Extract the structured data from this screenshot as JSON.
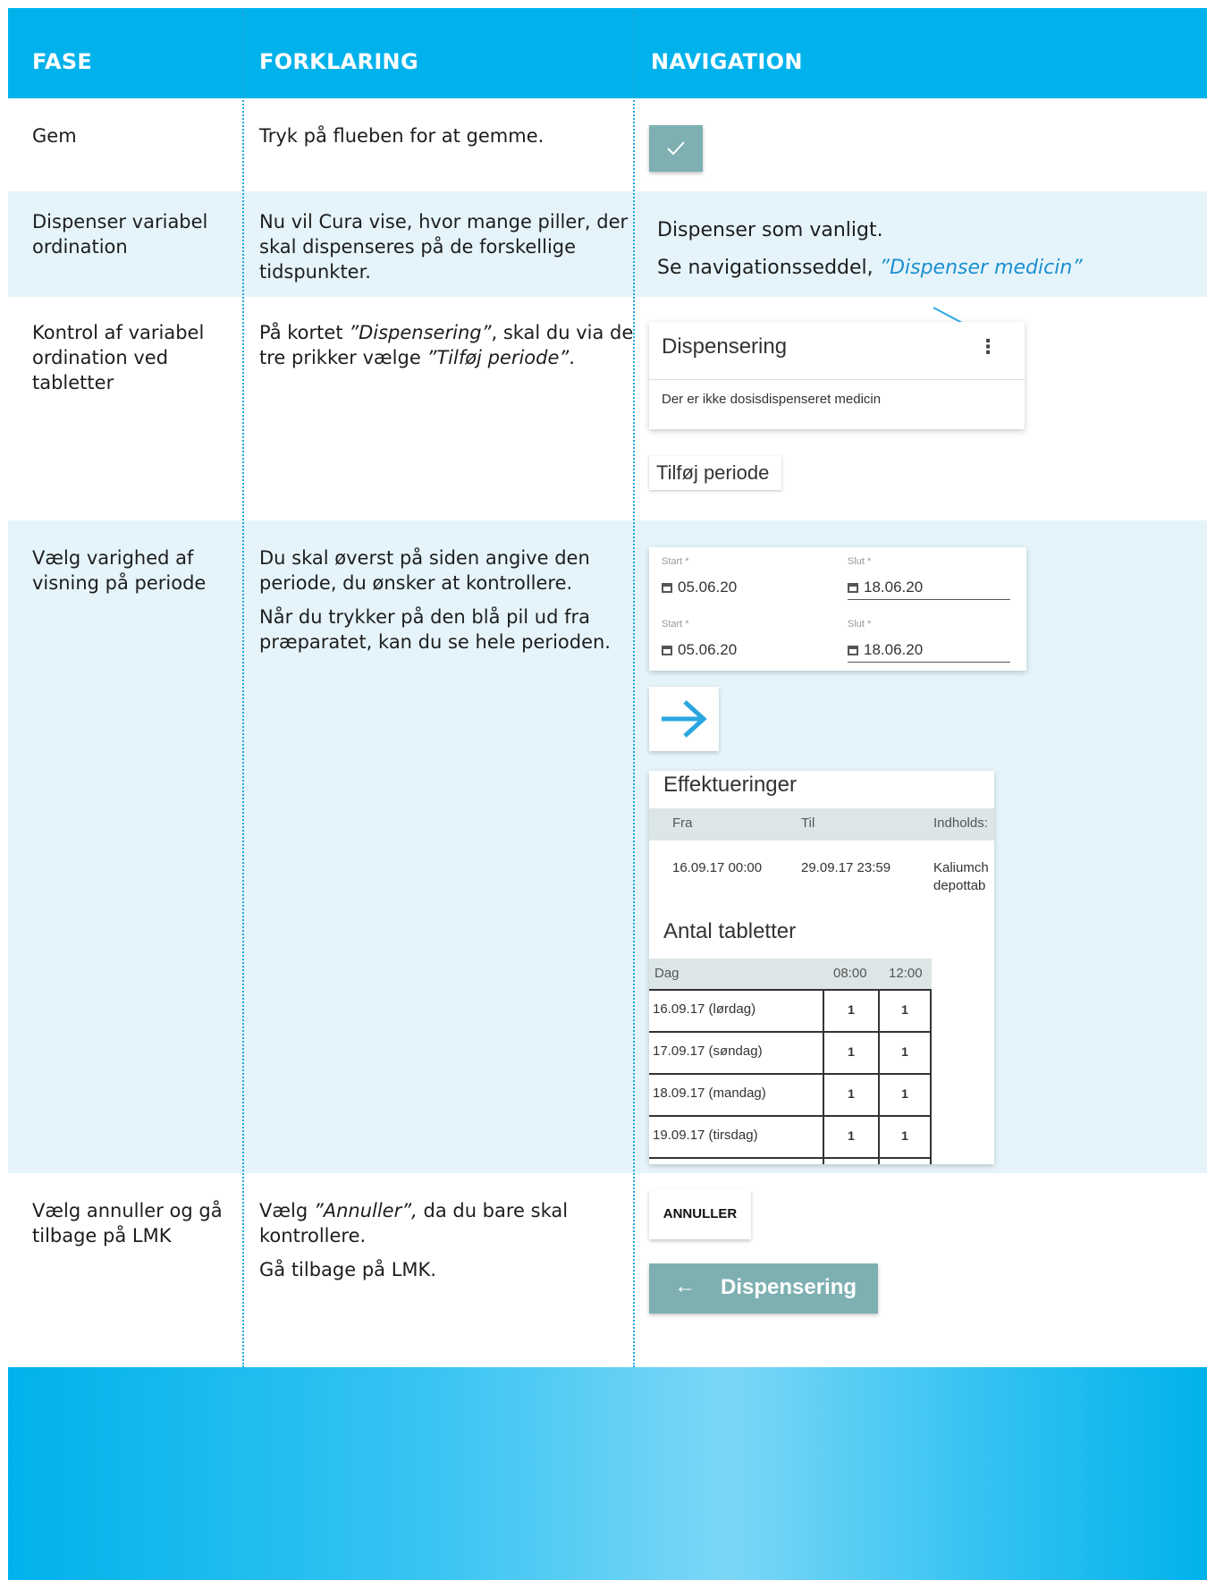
{
  "header": {
    "col1": "FASE",
    "col2": "FORKLARING",
    "col3": "NAVIGATION"
  },
  "rows": [
    {
      "fase": "Gem",
      "forklaring": [
        "Tryk på flueben for at gemme."
      ]
    },
    {
      "fase": "Dispenser variabel ordination",
      "forklaring": [
        "Nu vil Cura vise, hvor mange piller, der skal dispenseres på de forskellige tidspunkter."
      ],
      "nav_text": "Dispenser som vanligt.",
      "nav_text2_prefix": "Se navigationsseddel,",
      "nav_text2_link": "”Dispenser medicin”"
    },
    {
      "fase": "Kontrol af variabel ordination ved tabletter",
      "forklaring_p1": "På kortet",
      "forklaring_i1": "”Dispensering”",
      "forklaring_p2": ", skal du via de tre prikker vælge",
      "forklaring_i2": "”Tilføj periode”",
      "forklaring_p3": "."
    },
    {
      "fase": "Vælg varighed af visning på periode",
      "forklaring": [
        "Du skal øverst på siden angive den periode, du ønsker at kontrollere.",
        "Når du trykker på den blå pil ud fra præparatet, kan du se hele perioden."
      ]
    },
    {
      "fase": "Vælg annuller og gå tilbage på LMK",
      "forklaring_p1": "Vælg",
      "forklaring_i1": "”Annuller”,",
      "forklaring_p2": "da du bare skal kontrollere.",
      "forklaring_2": "Gå tilbage på LMK."
    }
  ],
  "nav": {
    "card_title": "Dispensering",
    "card_dots": "⋮",
    "card_sub": "Der er ikke dosisdispenseret medicin",
    "tilfoj": "Tilføj periode",
    "dates": [
      {
        "start_label": "Start *",
        "start": "05.06.20",
        "slut_label": "Slut *",
        "slut": "18.06.20"
      },
      {
        "start_label": "Start *",
        "start": "05.06.20",
        "slut_label": "Slut *",
        "slut": "18.06.20"
      }
    ],
    "eff_title": "Effektueringer",
    "eff_cols": [
      "Fra",
      "Til",
      "Indholds:"
    ],
    "eff_row": {
      "fra": "16.09.17 00:00",
      "til": "29.09.17 23:59",
      "ind1": "Kaliumch",
      "ind2": "depottab"
    },
    "antal_title": "Antal tabletter",
    "antal_cols": [
      "Dag",
      "08:00",
      "12:00"
    ],
    "antal_rows": [
      {
        "dag": "16.09.17 (lørdag)",
        "a": "1",
        "b": "1"
      },
      {
        "dag": "17.09.17 (søndag)",
        "a": "1",
        "b": "1"
      },
      {
        "dag": "18.09.17 (mandag)",
        "a": "1",
        "b": "1"
      },
      {
        "dag": "19.09.17 (tirsdag)",
        "a": "1",
        "b": "1"
      }
    ],
    "annuller": "ANNULLER",
    "back_arrow": "←",
    "back_label": "Dispensering"
  },
  "colors": {
    "header": "#00b2ec",
    "alt_row": "#e5f4fb",
    "button": "#7eb0b2",
    "link": "#1a8fcf"
  }
}
